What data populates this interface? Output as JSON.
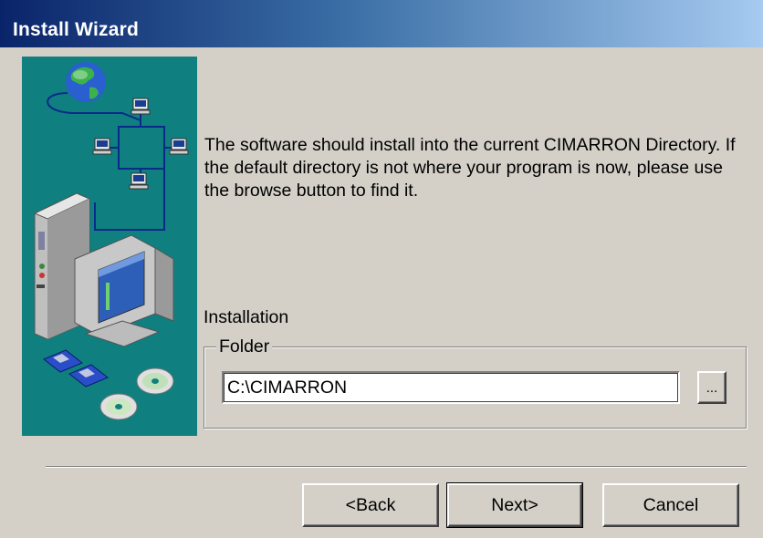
{
  "window": {
    "title": "Install Wizard"
  },
  "content": {
    "description": "The software should install into the current CIMARRON Directory. If the default directory is not where your program is now, please use the browse button to find it.",
    "installation_label": "Installation",
    "folder_group_label": "Folder",
    "folder_value": "C:\\CIMARRON",
    "browse_label": "..."
  },
  "buttons": {
    "back": "<Back",
    "next": "Next>",
    "cancel": "Cancel"
  },
  "colors": {
    "titlebar_start": "#0a246a",
    "titlebar_end": "#a6caf0",
    "art_background": "#0f7f80",
    "dialog_background": "#d4d0c8"
  },
  "icons": [
    "globe-icon",
    "network-computer-icon",
    "desktop-computer-icon",
    "floppy-disk-icon",
    "cd-disc-icon"
  ]
}
